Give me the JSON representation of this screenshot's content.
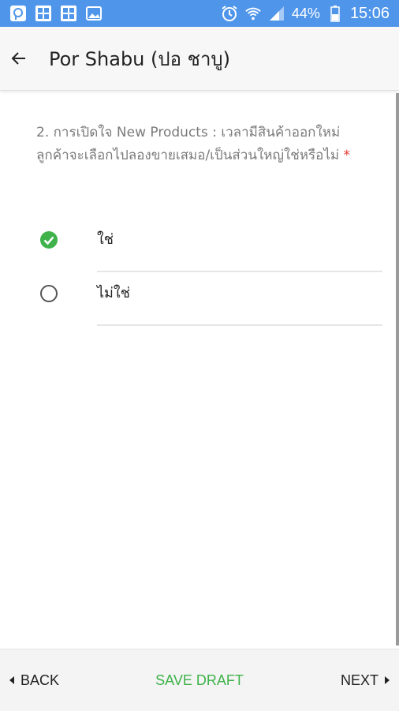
{
  "status_bar": {
    "battery": "44%",
    "time": "15:06",
    "icons": [
      "app-icon",
      "grid-icon",
      "grid-icon",
      "image-icon",
      "alarm-icon",
      "wifi-icon",
      "signal-icon",
      "battery-icon"
    ],
    "color": "#4f95ea"
  },
  "app_bar": {
    "title": "Por Shabu (ปอ ชาบู)"
  },
  "question": {
    "text": "2. การเปิดใจ New Products : เวลามีสินค้าออกใหม่ ลูกค้าจะเลือกไปลองขายเสมอ/เป็นส่วนใหญ่ใช่หรือไม่",
    "required_mark": "*"
  },
  "options": [
    {
      "label": "ใช่",
      "selected": true
    },
    {
      "label": "ไม่ใช่",
      "selected": false
    }
  ],
  "bottom_bar": {
    "back_label": "BACK",
    "save_label": "SAVE DRAFT",
    "next_label": "NEXT"
  },
  "colors": {
    "accent_green": "#3fb24a",
    "status_bar": "#4f95ea",
    "required": "#e53935"
  }
}
